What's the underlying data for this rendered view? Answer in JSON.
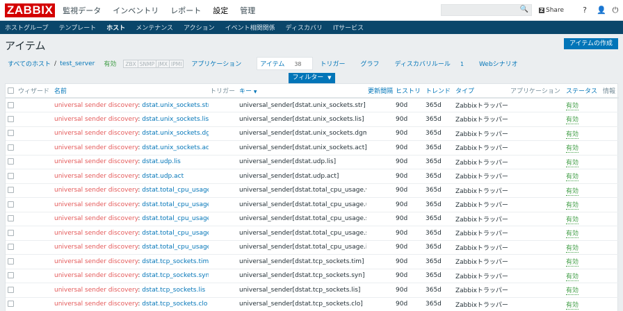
{
  "header": {
    "logo": "ZABBIX",
    "nav": [
      "監視データ",
      "インベントリ",
      "レポート",
      "設定",
      "管理"
    ],
    "nav_active": "設定",
    "share_label": "Share",
    "share_badge": "Z",
    "help_icon": "?",
    "user_icon": "👤",
    "power_icon": "⏻",
    "search_icon": "🔍"
  },
  "subnav": [
    "ホストグループ",
    "テンプレート",
    "ホスト",
    "メンテナンス",
    "アクション",
    "イベント相関関係",
    "ディスカバリ",
    "ITサービス"
  ],
  "subnav_active": "ホスト",
  "page": {
    "title": "アイテム",
    "create_button": "アイテムの作成"
  },
  "breadcrumbs": {
    "all_hosts": "すべてのホスト",
    "separator": "/",
    "host": "test_server",
    "status": "有効",
    "availability": [
      "ZBX",
      "SNMP",
      "JMX",
      "IPMI"
    ],
    "tabs": [
      {
        "label": "アプリケーション",
        "count": ""
      },
      {
        "label": "アイテム",
        "count": "38"
      },
      {
        "label": "トリガー",
        "count": ""
      },
      {
        "label": "グラフ",
        "count": ""
      },
      {
        "label": "ディスカバリルール",
        "count": "1"
      },
      {
        "label": "Webシナリオ",
        "count": ""
      }
    ]
  },
  "filter": {
    "label": "フィルター",
    "arrow": "▼"
  },
  "table": {
    "headers": {
      "wizard": "ウィザード",
      "name": "名前",
      "triggers": "トリガー",
      "key": "キー",
      "key_sort": "▼",
      "interval": "更新間隔",
      "history": "ヒストリ",
      "trends": "トレンド",
      "type": "タイプ",
      "applications": "アプリケーション",
      "status": "ステータス",
      "info": "情報"
    },
    "rows": [
      {
        "prefix": "universal sender discovery",
        "sep": ": ",
        "name": "dstat.unix_sockets.str",
        "key": "universal_sender[dstat.unix_sockets.str]",
        "history": "90d",
        "trends": "365d",
        "type": "Zabbixトラッパー",
        "status": "有効"
      },
      {
        "prefix": "universal sender discovery",
        "sep": ": ",
        "name": "dstat.unix_sockets.lis",
        "key": "universal_sender[dstat.unix_sockets.lis]",
        "history": "90d",
        "trends": "365d",
        "type": "Zabbixトラッパー",
        "status": "有効"
      },
      {
        "prefix": "universal sender discovery",
        "sep": ": ",
        "name": "dstat.unix_sockets.dgm",
        "key": "universal_sender[dstat.unix_sockets.dgm]",
        "history": "90d",
        "trends": "365d",
        "type": "Zabbixトラッパー",
        "status": "有効"
      },
      {
        "prefix": "universal sender discovery",
        "sep": ": ",
        "name": "dstat.unix_sockets.act",
        "key": "universal_sender[dstat.unix_sockets.act]",
        "history": "90d",
        "trends": "365d",
        "type": "Zabbixトラッパー",
        "status": "有効"
      },
      {
        "prefix": "universal sender discovery",
        "sep": ": ",
        "name": "dstat.udp.lis",
        "key": "universal_sender[dstat.udp.lis]",
        "history": "90d",
        "trends": "365d",
        "type": "Zabbixトラッパー",
        "status": "有効"
      },
      {
        "prefix": "universal sender discovery",
        "sep": ": ",
        "name": "dstat.udp.act",
        "key": "universal_sender[dstat.udp.act]",
        "history": "90d",
        "trends": "365d",
        "type": "Zabbixトラッパー",
        "status": "有効"
      },
      {
        "prefix": "universal sender discovery",
        "sep": ": ",
        "name": "dstat.total_cpu_usage.wai",
        "key": "universal_sender[dstat.total_cpu_usage.wai]",
        "history": "90d",
        "trends": "365d",
        "type": "Zabbixトラッパー",
        "status": "有効"
      },
      {
        "prefix": "universal sender discovery",
        "sep": ": ",
        "name": "dstat.total_cpu_usage.usr",
        "key": "universal_sender[dstat.total_cpu_usage.usr]",
        "history": "90d",
        "trends": "365d",
        "type": "Zabbixトラッパー",
        "status": "有効"
      },
      {
        "prefix": "universal sender discovery",
        "sep": ": ",
        "name": "dstat.total_cpu_usage.sys",
        "key": "universal_sender[dstat.total_cpu_usage.sys]",
        "history": "90d",
        "trends": "365d",
        "type": "Zabbixトラッパー",
        "status": "有効"
      },
      {
        "prefix": "universal sender discovery",
        "sep": ": ",
        "name": "dstat.total_cpu_usage.stl",
        "key": "universal_sender[dstat.total_cpu_usage.stl]",
        "history": "90d",
        "trends": "365d",
        "type": "Zabbixトラッパー",
        "status": "有効"
      },
      {
        "prefix": "universal sender discovery",
        "sep": ": ",
        "name": "dstat.total_cpu_usage.idl",
        "key": "universal_sender[dstat.total_cpu_usage.idl]",
        "history": "90d",
        "trends": "365d",
        "type": "Zabbixトラッパー",
        "status": "有効"
      },
      {
        "prefix": "universal sender discovery",
        "sep": ": ",
        "name": "dstat.tcp_sockets.tim",
        "key": "universal_sender[dstat.tcp_sockets.tim]",
        "history": "90d",
        "trends": "365d",
        "type": "Zabbixトラッパー",
        "status": "有効"
      },
      {
        "prefix": "universal sender discovery",
        "sep": ": ",
        "name": "dstat.tcp_sockets.syn",
        "key": "universal_sender[dstat.tcp_sockets.syn]",
        "history": "90d",
        "trends": "365d",
        "type": "Zabbixトラッパー",
        "status": "有効"
      },
      {
        "prefix": "universal sender discovery",
        "sep": ": ",
        "name": "dstat.tcp_sockets.lis",
        "key": "universal_sender[dstat.tcp_sockets.lis]",
        "history": "90d",
        "trends": "365d",
        "type": "Zabbixトラッパー",
        "status": "有効"
      },
      {
        "prefix": "universal sender discovery",
        "sep": ": ",
        "name": "dstat.tcp_sockets.clo",
        "key": "universal_sender[dstat.tcp_sockets.clo]",
        "history": "90d",
        "trends": "365d",
        "type": "Zabbixトラッパー",
        "status": "有効"
      }
    ]
  }
}
